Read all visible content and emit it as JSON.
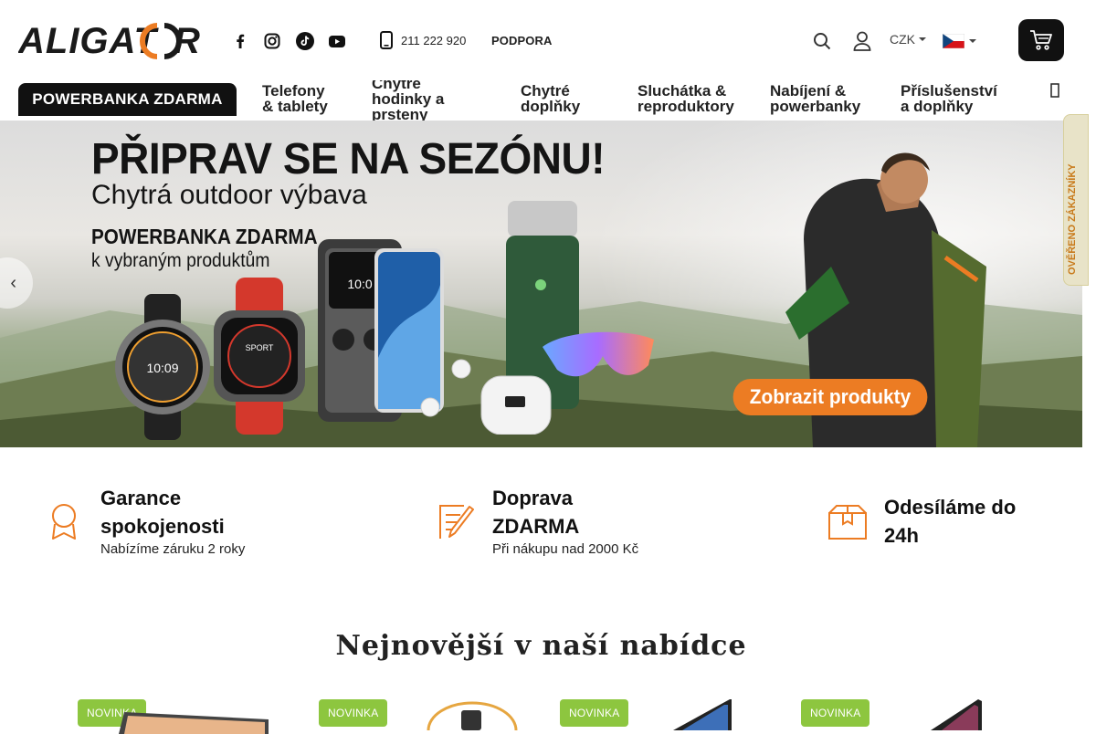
{
  "header": {
    "logo": "ALIGATOR",
    "phone": "211 222 920",
    "support": "PODPORA",
    "currency": "CZK"
  },
  "social": [
    "facebook-icon",
    "instagram-icon",
    "tiktok-icon",
    "youtube-icon"
  ],
  "nav": {
    "promo": "POWERBANKA ZDARMA",
    "items": [
      {
        "line1": "Telefony",
        "line2": "& tablety"
      },
      {
        "line1": "Chytré",
        "line2": "hodinky a",
        "line3": "prsteny"
      },
      {
        "line1": "Chytré",
        "line2": "doplňky"
      },
      {
        "line1": "Sluchátka &",
        "line2": "reproduktory"
      },
      {
        "line1": "Nabíjení &",
        "line2": "powerbanky"
      },
      {
        "line1": "Příslušenství",
        "line2": "a doplňky"
      }
    ]
  },
  "banner": {
    "title": "PŘIPRAV SE NA SEZÓNU!",
    "subtitle": "Chytrá outdoor výbava",
    "promo_line1": "POWERBANKA ZDARMA",
    "promo_line2": "k vybraným produktům",
    "cta": "Zobrazit produkty"
  },
  "side_badge": "OVĚŘENO ZÁKAZNÍKY",
  "benefits": [
    {
      "title_line1": "Garance",
      "title_line2": "spokojenosti",
      "desc": "Nabízíme záruku 2 roky",
      "icon": "award-icon"
    },
    {
      "title_line1": "Doprava",
      "title_line2": "ZDARMA",
      "desc": "Při nákupu nad 2000 Kč",
      "icon": "pen-icon"
    },
    {
      "title_line1": "Odesíláme do",
      "title_line2": "24h",
      "desc": "",
      "icon": "package-icon"
    }
  ],
  "section_title": "Nejnovější v naší nabídce",
  "products": [
    {
      "tag": "NOVINKA"
    },
    {
      "tag": "NOVINKA"
    },
    {
      "tag": "NOVINKA"
    },
    {
      "tag": "NOVINKA"
    }
  ],
  "colors": {
    "accent": "#ec7c23",
    "dark": "#111111",
    "tag": "#8dc63f"
  }
}
